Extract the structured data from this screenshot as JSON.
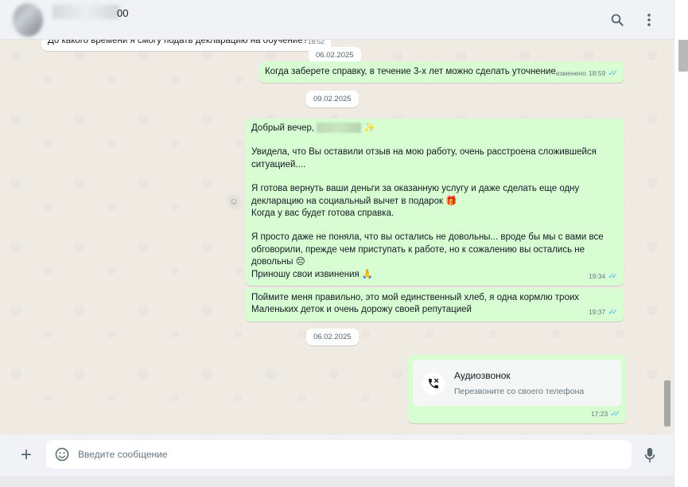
{
  "header": {
    "contact_name_visible_suffix": "00",
    "search_icon": "search-icon",
    "menu_icon": "menu-dots-icon"
  },
  "messages": [
    {
      "id": "m0",
      "direction": "in",
      "text": "До какого времени я смогу подать декларацию на обучение?",
      "time": "18:52"
    },
    {
      "id": "d1",
      "type": "date",
      "text": "06.02.2025"
    },
    {
      "id": "m1",
      "direction": "out",
      "text": "Когда заберете справку, в течение 3-х лет можно сделать уточнение",
      "edited": "изменено",
      "time": "18:59"
    },
    {
      "id": "d2",
      "type": "date",
      "text": "09.02.2025"
    },
    {
      "id": "m2",
      "direction": "out",
      "time": "19:34",
      "lines": {
        "greeting": "Добрый вечер, ",
        "sparkle": "✨",
        "p1": "Увидела, что Вы оставили отзыв на мою работу, очень расстроена сложившейся ситуацией....",
        "p2a": "Я готова вернуть ваши деньги за оказанную услугу и даже сделать еще одну декларацию на социальный вычет в подарок ",
        "gift": "🎁",
        "p2b": "Когда у вас будет готова справка.",
        "p3": "Я просто даже не поняла, что вы остались не довольны... вроде бы мы с вами все обговорили, прежде чем приступать к работе, но к сожалению вы остались не довольны ",
        "pensive": "😔",
        "p4": "Приношу свои извинения ",
        "pray": "🙏"
      }
    },
    {
      "id": "m3",
      "direction": "out",
      "text": "Поймите меня правильно, это мой единственный хлеб, я одна кормлю троих Маленьких деток и очень дорожу своей репутацией",
      "time": "19:37"
    },
    {
      "id": "d3",
      "type": "date",
      "text": "06.02.2025"
    },
    {
      "id": "m4",
      "direction": "out",
      "type": "call",
      "title": "Аудиозвонок",
      "subtitle": "Перезвоните со своего телефона",
      "time": "17:23"
    }
  ],
  "composer": {
    "placeholder": "Введите сообщение",
    "value": ""
  },
  "colors": {
    "outgoing_bubble": "#d9fdd3",
    "incoming_bubble": "#ffffff",
    "chat_background": "#efeae2",
    "read_ticks": "#53bdeb"
  }
}
